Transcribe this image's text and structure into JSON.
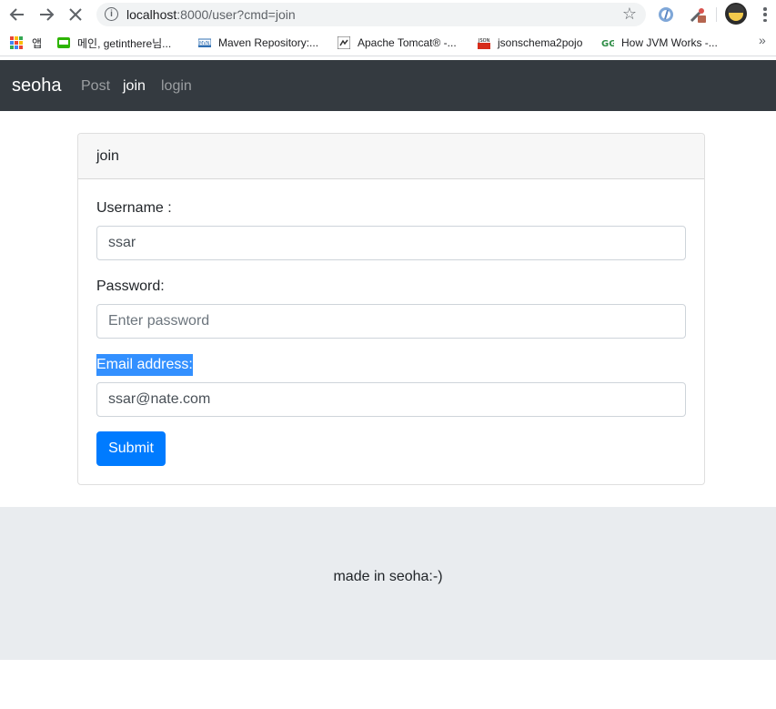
{
  "browser": {
    "url_host": "localhost",
    "url_rest": ":8000/user?cmd=join",
    "bookmarks": [
      {
        "label": "앱",
        "icon": "apps-grid-icon"
      },
      {
        "label": "메인, getinthere님...",
        "icon": "blog-icon"
      },
      {
        "label": "Maven Repository:...",
        "icon": "maven-icon"
      },
      {
        "label": "Apache Tomcat® -...",
        "icon": "tomcat-icon"
      },
      {
        "label": "jsonschema2pojo",
        "icon": "json-icon"
      },
      {
        "label": "How JVM Works -...",
        "icon": "geeksforgeeks-icon"
      }
    ],
    "more_label": "»"
  },
  "navbar": {
    "brand": "seoha",
    "links": [
      {
        "label": "Post",
        "active": false
      },
      {
        "label": "join",
        "active": true
      },
      {
        "label": "login",
        "active": false
      }
    ]
  },
  "card": {
    "header": "join",
    "username_label": "Username :",
    "username_value": "ssar",
    "password_label": "Password:",
    "password_placeholder": "Enter password",
    "email_label": "Email address:",
    "email_value": "ssar@nate.com",
    "submit_label": "Submit"
  },
  "footer": {
    "text": "made in seoha:-)"
  },
  "colors": {
    "navbar_bg": "#343a40",
    "primary": "#007bff",
    "footer_bg": "#e9ecef",
    "selection": "#3390ff"
  }
}
